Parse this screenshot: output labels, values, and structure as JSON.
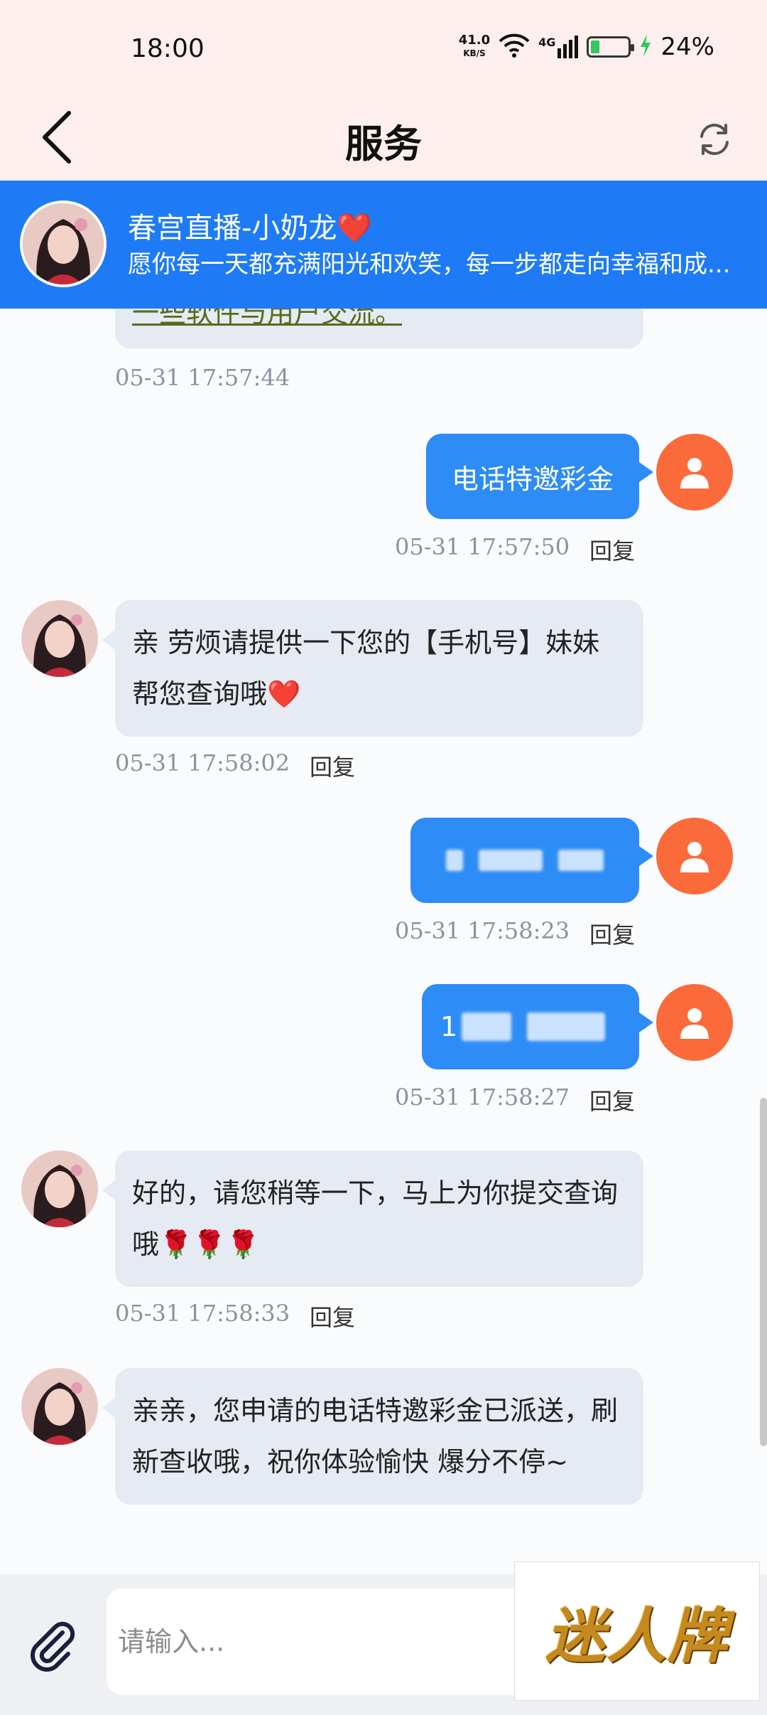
{
  "status_bar": {
    "time": "18:00",
    "net_speed_value": "41.0",
    "net_speed_unit": "KB/S",
    "signal_label": "4G",
    "battery": "24%"
  },
  "header": {
    "title": "服务",
    "back_icon": "chevron-left-icon",
    "refresh_icon": "refresh-icon"
  },
  "banner": {
    "name": "春宫直播-小奶龙❤️",
    "message": "愿你每一天都充满阳光和欢笑，每一步都走向幸福和成..."
  },
  "messages": [
    {
      "side": "left",
      "text": "一些软件与用户交流。",
      "time": "05-31 17:57:44",
      "reply": ""
    },
    {
      "side": "right",
      "text": "电话特邀彩金",
      "time": "05-31 17:57:50",
      "reply": "回复"
    },
    {
      "side": "left",
      "text": "亲 劳烦请提供一下您的【手机号】妹妹帮您查询哦❤️",
      "time": "05-31 17:58:02",
      "reply": "回复"
    },
    {
      "side": "right",
      "text": "",
      "time": "05-31 17:58:23",
      "reply": "回复"
    },
    {
      "side": "right",
      "text": "1",
      "time": "05-31 17:58:27",
      "reply": "回复"
    },
    {
      "side": "left",
      "text": "好的，请您稍等一下，马上为你提交查询哦🌹🌹🌹",
      "time": "05-31 17:58:33",
      "reply": "回复"
    },
    {
      "side": "left",
      "text": "亲亲，您申请的电话特邀彩金已派送，刷新查收哦，祝你体验愉快 爆分不停~",
      "time": "",
      "reply": ""
    }
  ],
  "input": {
    "placeholder": "请输入..."
  },
  "logo": {
    "text": "迷人牌"
  },
  "colors": {
    "banner": "#1e7bf5",
    "bubble_right": "#2d8cf6",
    "bubble_left": "#e6eaf2",
    "user_avatar": "#fb6a3a",
    "header_bg": "#fcefee"
  }
}
